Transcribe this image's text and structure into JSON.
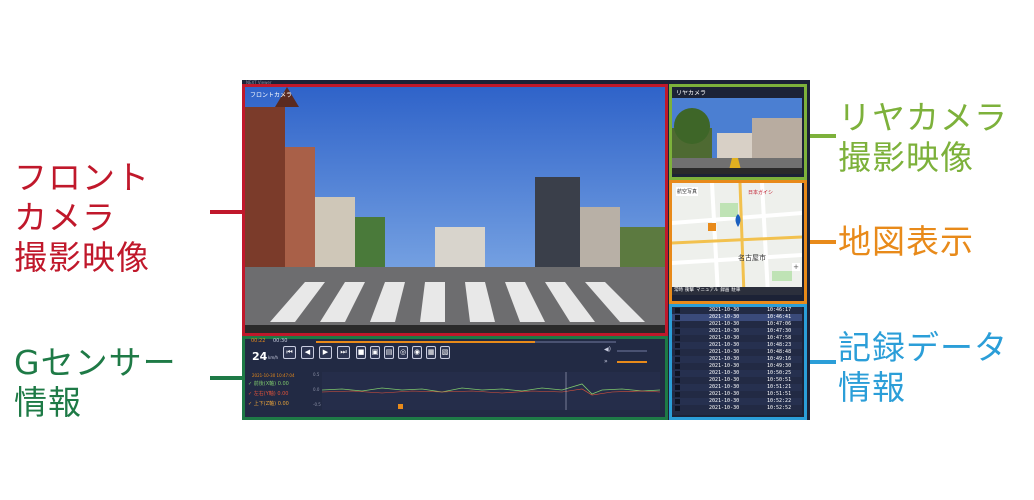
{
  "callouts": {
    "front": "フロント\nカメラ\n撮影映像",
    "rear": "リヤカメラ\n撮影映像",
    "map": "地図表示",
    "gsensor": "Gセンサー\n情報",
    "records": "記録データ\n情報"
  },
  "colors": {
    "front": "#c0182b",
    "rear": "#7db13b",
    "map": "#e88a1a",
    "gsensor": "#1e7a46",
    "records": "#2b9ed8",
    "app_bg": "#1c2236"
  },
  "app": {
    "title": "NEXT Viewer",
    "front_label": "フロントカメラ",
    "rear_label": "リヤカメラ",
    "map": {
      "place1": "名古屋市",
      "place2": "航空写真",
      "marker": "日本ガイシ",
      "tabs": [
        "常時",
        "衝撃",
        "マニュアル",
        "録画",
        "駐車"
      ]
    },
    "player": {
      "time_current": "00:22",
      "time_total": "00:30",
      "speed": "24",
      "speed_unit": "km/h",
      "buttons": [
        "skip-back",
        "step-back",
        "play",
        "skip-forward",
        "stop",
        "snapshot",
        "folder",
        "settings",
        "zoom",
        "export",
        "open"
      ],
      "timestamp": "2021-10-30 10:47:04",
      "axes": [
        {
          "name": "前後(X軸)",
          "value": "0.00"
        },
        {
          "name": "左右(Y軸)",
          "value": "0.00"
        },
        {
          "name": "上下(Z軸)",
          "value": "0.00"
        }
      ],
      "tick_labels": [
        "0.5",
        "0.0",
        "-0.5"
      ]
    },
    "records": [
      {
        "date": "2021-10-30",
        "time": "10:46:17"
      },
      {
        "date": "2021-10-30",
        "time": "10:46:41"
      },
      {
        "date": "2021-10-30",
        "time": "10:47:06"
      },
      {
        "date": "2021-10-30",
        "time": "10:47:30"
      },
      {
        "date": "2021-10-30",
        "time": "10:47:58"
      },
      {
        "date": "2021-10-30",
        "time": "10:48:23"
      },
      {
        "date": "2021-10-30",
        "time": "10:48:48"
      },
      {
        "date": "2021-10-30",
        "time": "10:49:16"
      },
      {
        "date": "2021-10-30",
        "time": "10:49:30"
      },
      {
        "date": "2021-10-30",
        "time": "10:50:25"
      },
      {
        "date": "2021-10-30",
        "time": "10:50:51"
      },
      {
        "date": "2021-10-30",
        "time": "10:51:21"
      },
      {
        "date": "2021-10-30",
        "time": "10:51:51"
      },
      {
        "date": "2021-10-30",
        "time": "10:52:22"
      },
      {
        "date": "2021-10-30",
        "time": "10:52:52"
      }
    ]
  }
}
